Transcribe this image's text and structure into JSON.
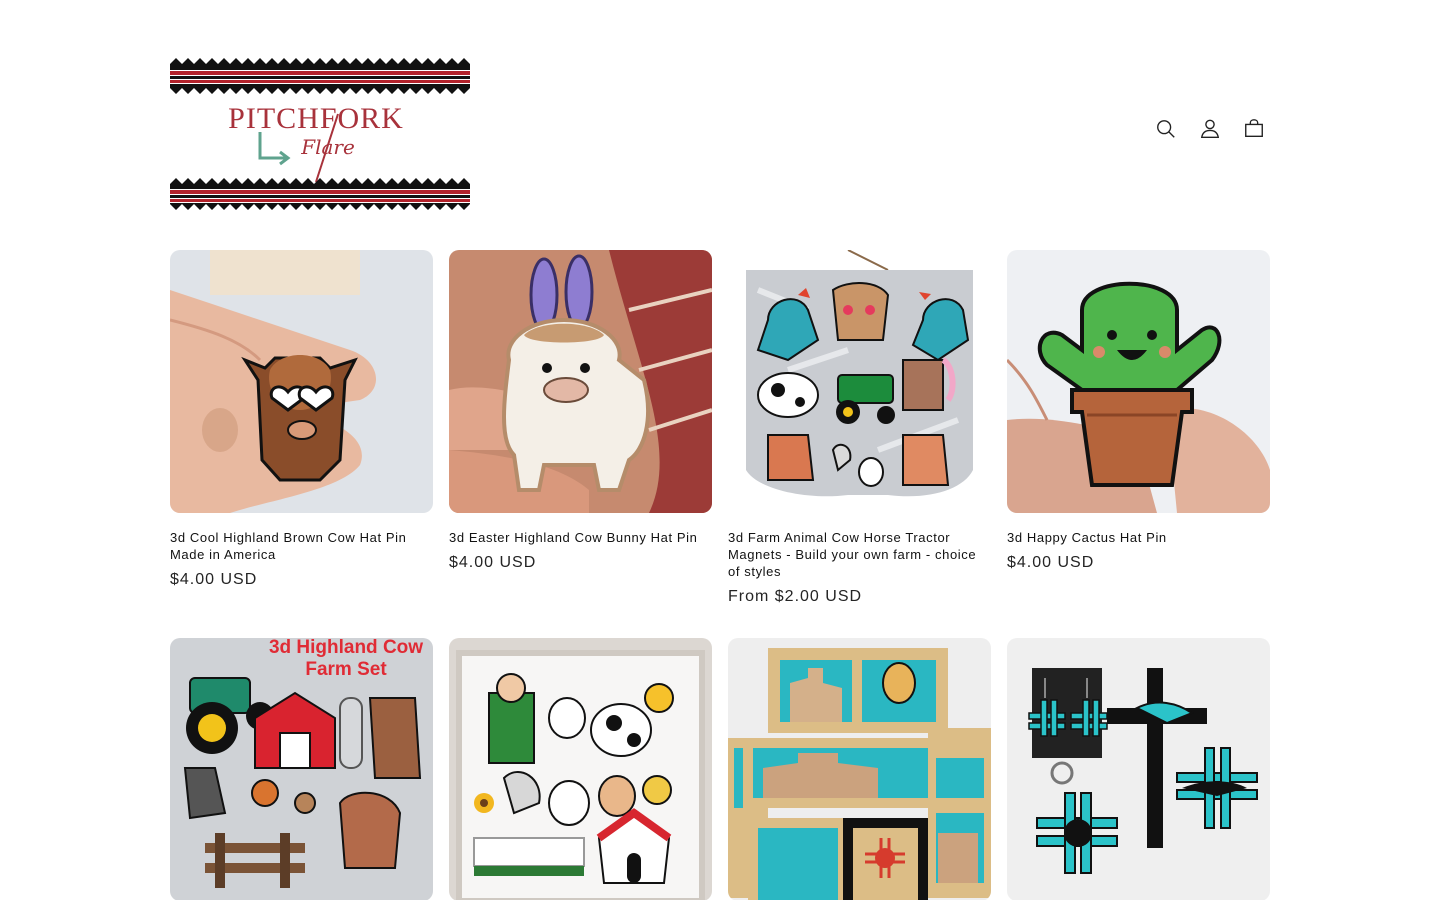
{
  "header": {
    "brand_line1": "PITCHFORK",
    "brand_line2": "Flare",
    "icons": [
      "search-icon",
      "account-icon",
      "cart-icon"
    ]
  },
  "products": [
    {
      "title": "3d Cool Highland Brown Cow Hat Pin Made in America",
      "price": "$4.00 USD"
    },
    {
      "title": "3d Easter Highland Cow Bunny Hat Pin",
      "price": "$4.00 USD"
    },
    {
      "title": "3d Farm Animal Cow Horse Tractor Magnets - Build your own farm - choice of styles",
      "price": "From $2.00 USD"
    },
    {
      "title": "3d Happy Cactus Hat Pin",
      "price": "$4.00 USD"
    }
  ],
  "row2_images": {
    "farm_set_caption_line1": "3d Highland Cow",
    "farm_set_caption_line2": "Farm Set"
  },
  "colors": {
    "brand_red": "#b3222b",
    "brand_teal": "#5fa38e",
    "text": "#121212"
  }
}
